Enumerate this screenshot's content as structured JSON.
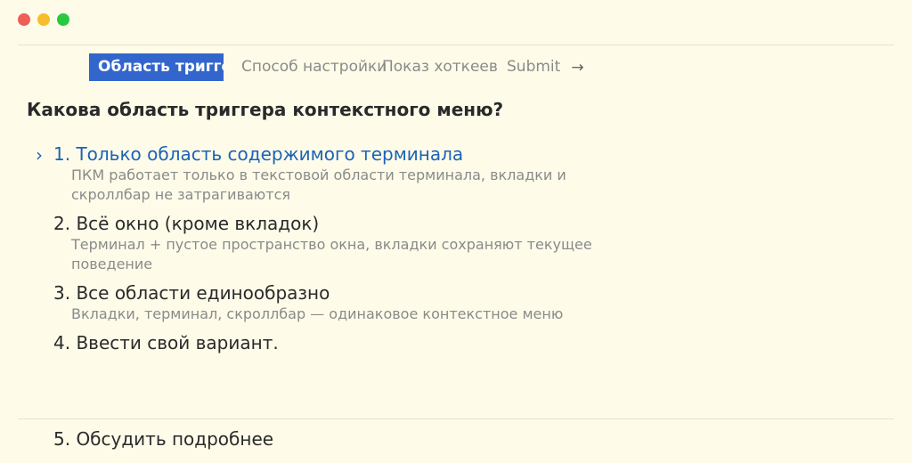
{
  "tabs": [
    {
      "label": "Область триггера"
    },
    {
      "label": "Способ настройки"
    },
    {
      "label": "Показ хоткеев"
    },
    {
      "label": "Submit"
    }
  ],
  "tabs_arrow": "→",
  "question": "Какова область триггера контекстного меню?",
  "caret": "›",
  "options": [
    {
      "label": "1. Только область содержимого терминала",
      "description": "ПКМ работает только в текстовой области терминала, вкладки и скроллбар не затрагиваются"
    },
    {
      "label": "2. Всё окно (кроме вкладок)",
      "description": "Терминал + пустое пространство окна, вкладки сохраняют текущее поведение"
    },
    {
      "label": "3. Все области единообразно",
      "description": "Вкладки, терминал, скроллбар — одинаковое контекстное меню"
    },
    {
      "label": "4. Ввести свой вариант.",
      "description": ""
    }
  ],
  "discuss": "5. Обсудить подробнее"
}
